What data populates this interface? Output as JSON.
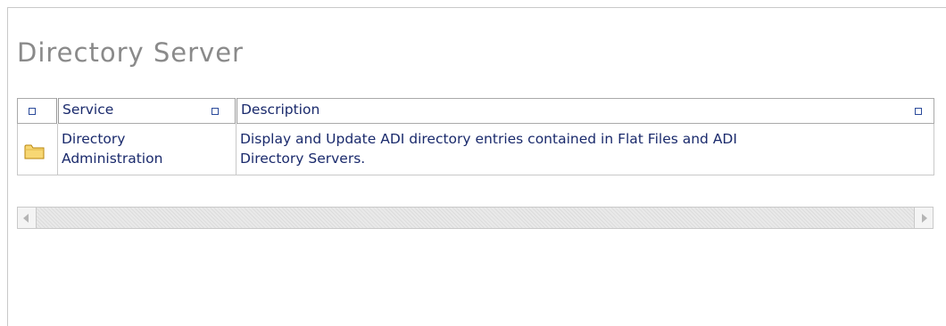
{
  "page": {
    "title": "Directory Server"
  },
  "table": {
    "columns": [
      {
        "label": ""
      },
      {
        "label": "Service"
      },
      {
        "label": "Description"
      }
    ],
    "rows": [
      {
        "icon": "folder-icon",
        "service_line1": "Directory",
        "service_line2": "Administration",
        "description_line1": "Display and Update ADI directory entries contained in Flat Files and ADI",
        "description_line2": "Directory Servers."
      }
    ]
  },
  "colors": {
    "title": "#8a8a8a",
    "link_text": "#1a2a6c",
    "folder": "#f2c94c"
  }
}
